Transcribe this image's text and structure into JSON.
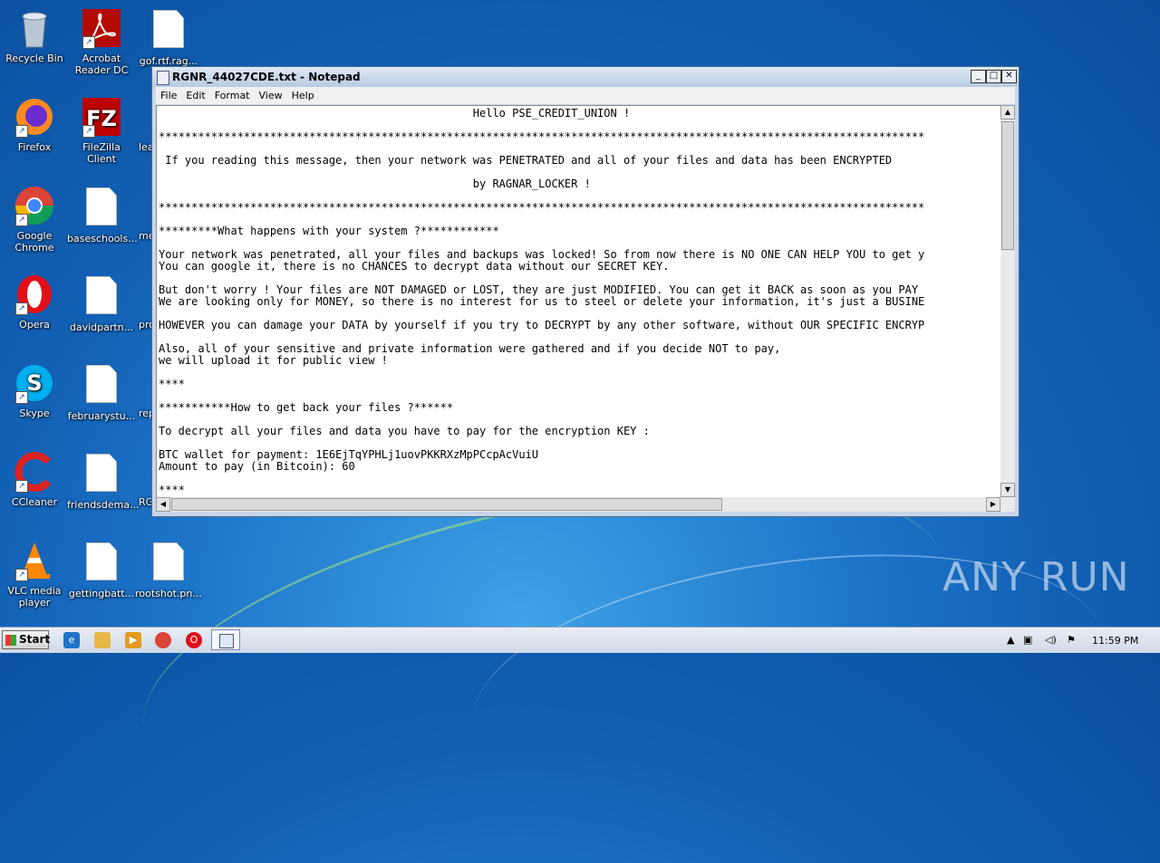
{
  "desktop": {
    "icons": [
      {
        "label": "Recycle Bin"
      },
      {
        "label": "Acrobat\nReader DC"
      },
      {
        "label": "gof.rtf.rag..."
      },
      {
        "label": "Firefox"
      },
      {
        "label": "FileZilla Client"
      },
      {
        "label": "lea"
      },
      {
        "label": "Google\nChrome"
      },
      {
        "label": "baseschools..."
      },
      {
        "label": "me"
      },
      {
        "label": "Opera"
      },
      {
        "label": "davidpartn..."
      },
      {
        "label": "pro"
      },
      {
        "label": "Skype"
      },
      {
        "label": "februarystu..."
      },
      {
        "label": "rep"
      },
      {
        "label": "CCleaner"
      },
      {
        "label": "friendsdema..."
      },
      {
        "label": "RG"
      },
      {
        "label": "VLC media\nplayer"
      },
      {
        "label": "gettingbatt..."
      },
      {
        "label": "rootshot.pn..."
      }
    ]
  },
  "window": {
    "title": "RGNR_44027CDE.txt - Notepad",
    "controls": {
      "minimize": "_",
      "maximize": "□",
      "close": "✕"
    },
    "menu": [
      "File",
      "Edit",
      "Format",
      "View",
      "Help"
    ],
    "content": "                                                Hello PSE_CREDIT_UNION !\n\n*********************************************************************************************************************\n\n If you reading this message, then your network was PENETRATED and all of your files and data has been ENCRYPTED\n\n                                                by RAGNAR_LOCKER !\n\n*********************************************************************************************************************\n\n*********What happens with your system ?************\n\nYour network was penetrated, all your files and backups was locked! So from now there is NO ONE CAN HELP YOU to get y\nYou can google it, there is no CHANCES to decrypt data without our SECRET KEY.\n\nBut don't worry ! Your files are NOT DAMAGED or LOST, they are just MODIFIED. You can get it BACK as soon as you PAY\nWe are looking only for MONEY, so there is no interest for us to steel or delete your information, it's just a BUSINE\n\nHOWEVER you can damage your DATA by yourself if you try to DECRYPT by any other software, without OUR SPECIFIC ENCRYP\n\nAlso, all of your sensitive and private information were gathered and if you decide NOT to pay,\nwe will upload it for public view !\n\n****\n\n***********How to get back your files ?******\n\nTo decrypt all your files and data you have to pay for the encryption KEY :\n\nBTC wallet for payment: 1E6EjTqYPHLj1uovPKKRXzMpPCcpAcVuiU\nAmount to pay (in Bitcoin): 60\n\n****"
  },
  "watermark": "ANY RUN",
  "taskbar": {
    "start_label": "Start",
    "clock": "11:59 PM"
  },
  "colors": {
    "desktop_bg": "#1565bb",
    "titlebar": "#c8d6e8",
    "taskbar": "#dfe6ef"
  }
}
